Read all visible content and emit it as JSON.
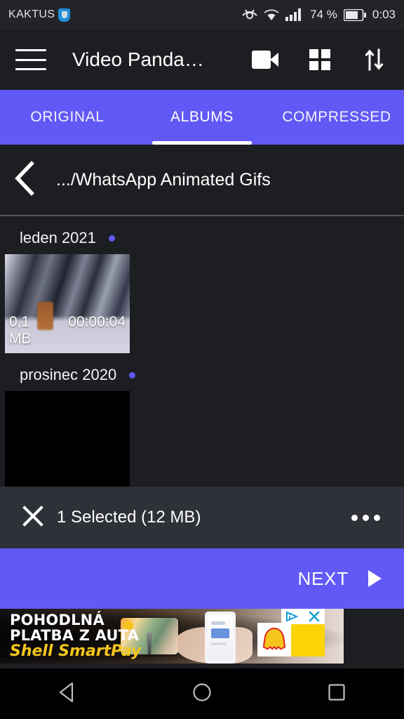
{
  "statusbar": {
    "carrier": "KAKTUS",
    "battery_percent": "74 %",
    "time": "0:03",
    "icons": [
      "shield-icon",
      "eye-care-icon",
      "wifi-icon",
      "signal-bars-icon",
      "battery-icon"
    ]
  },
  "appbar": {
    "menu_icon": "hamburger-menu-icon",
    "title": "Video Panda…",
    "actions": [
      {
        "icon": "video-camera-icon",
        "name": "record-video-button"
      },
      {
        "icon": "grid-view-icon",
        "name": "grid-view-button"
      },
      {
        "icon": "sort-icon",
        "name": "sort-button"
      }
    ]
  },
  "tabs": {
    "items": [
      {
        "label": "ORIGINAL",
        "active": false
      },
      {
        "label": "ALBUMS",
        "active": true
      },
      {
        "label": "COMPRESSED",
        "active": false
      }
    ]
  },
  "breadcrumb": {
    "back_icon": "back-chevron-icon",
    "path": ".../WhatsApp Animated Gifs"
  },
  "groups": [
    {
      "label": "leden 2021",
      "badge_color": "#6159F5",
      "items": [
        {
          "size": "0,1 MB",
          "duration": "00:00:04",
          "thumbnail": "snowy-forest"
        }
      ]
    },
    {
      "label": "prosinec 2020",
      "badge_color": "#6159F5",
      "items": [
        {
          "size": "",
          "duration": "",
          "thumbnail": "black"
        }
      ]
    }
  ],
  "selection_bar": {
    "close_icon": "close-icon",
    "text": "1 Selected (12 MB)",
    "overflow_icon": "more-options-icon"
  },
  "next_bar": {
    "label": "NEXT",
    "arrow_icon": "play-arrow-icon"
  },
  "ad": {
    "line1": "POHODLNÁ",
    "line2": "PLATBA Z AUTA",
    "line3": "Shell SmartPay",
    "adchoices_icon": "adchoices-icon",
    "close_icon": "ad-close-icon",
    "brand_icon": "shell-logo-icon"
  },
  "navbar": {
    "back": "nav-back-icon",
    "home": "nav-home-icon",
    "recents": "nav-recents-icon"
  },
  "colors": {
    "accent": "#6159F5",
    "app_background": "#1c1e22",
    "selection_bar": "#2e3138",
    "status_bar": "#222428"
  }
}
